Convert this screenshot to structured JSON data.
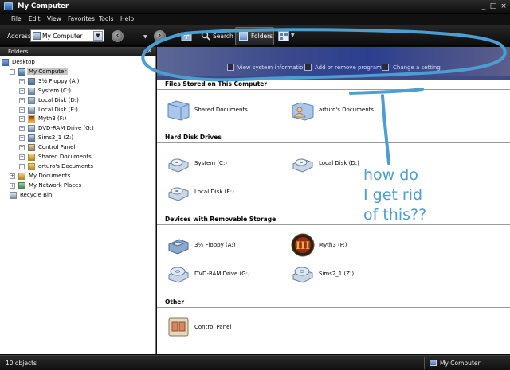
{
  "window": {
    "title": "My Computer",
    "controls": [
      "_",
      "□",
      "×"
    ]
  },
  "menu": [
    "File",
    "Edit",
    "View",
    "Favorites",
    "Tools",
    "Help"
  ],
  "toolbar": {
    "address_label": "Address",
    "address_value": "My Computer",
    "search_label": "Search",
    "folders_label": "Folders"
  },
  "folders_pane": {
    "title": "Folders",
    "close_glyph": "×",
    "tree": [
      {
        "label": "Desktop",
        "icon": "desktop-icon",
        "expander": ""
      },
      {
        "label": "My Computer",
        "icon": "computer-icon",
        "expander": "−",
        "selected": true
      },
      {
        "label": "3½ Floppy (A:)",
        "icon": "floppy-icon",
        "expander": "+"
      },
      {
        "label": "System (C:)",
        "icon": "disk-icon",
        "expander": "+"
      },
      {
        "label": "Local Disk (D:)",
        "icon": "disk-icon",
        "expander": "+"
      },
      {
        "label": "Local Disk (E:)",
        "icon": "disk-icon",
        "expander": "+"
      },
      {
        "label": "Myth3 (F:)",
        "icon": "myth-icon",
        "expander": "+"
      },
      {
        "label": "DVD-RAM Drive (G:)",
        "icon": "dvd-icon",
        "expander": "+"
      },
      {
        "label": "Sims2_1 (Z:)",
        "icon": "network-drive-icon",
        "expander": "+"
      },
      {
        "label": "Control Panel",
        "icon": "control-panel-icon",
        "expander": "+"
      },
      {
        "label": "Shared Documents",
        "icon": "folder-icon",
        "expander": "+"
      },
      {
        "label": "arturo's Documents",
        "icon": "folder-icon",
        "expander": "+"
      },
      {
        "label": "My Documents",
        "icon": "my-documents-icon",
        "expander": "+"
      },
      {
        "label": "My Network Places",
        "icon": "network-icon",
        "expander": "+"
      },
      {
        "label": "Recycle Bin",
        "icon": "recycle-bin-icon",
        "expander": ""
      }
    ]
  },
  "banner_links": [
    "View system information",
    "Add or remove programs",
    "Change a setting"
  ],
  "sections": {
    "files": {
      "title": "Files Stored on This Computer",
      "items": [
        "Shared Documents",
        "arturo's Documents"
      ]
    },
    "hard_disks": {
      "title": "Hard Disk Drives",
      "items": [
        "System (C:)",
        "Local Disk (D:)",
        "Local Disk (E:)"
      ]
    },
    "removable": {
      "title": "Devices with Removable Storage",
      "items": [
        "3½ Floppy (A:)",
        "Myth3 (F:)",
        "DVD-RAM Drive (G:)",
        "Sims2_1 (Z:)"
      ]
    },
    "other": {
      "title": "Other",
      "items": [
        "Control Panel"
      ]
    }
  },
  "status": {
    "count": "10 objects",
    "location": "My Computer"
  },
  "annotation": {
    "lines": [
      "how do",
      "I get rid",
      "of this??"
    ],
    "color": "#4a9ed2"
  }
}
